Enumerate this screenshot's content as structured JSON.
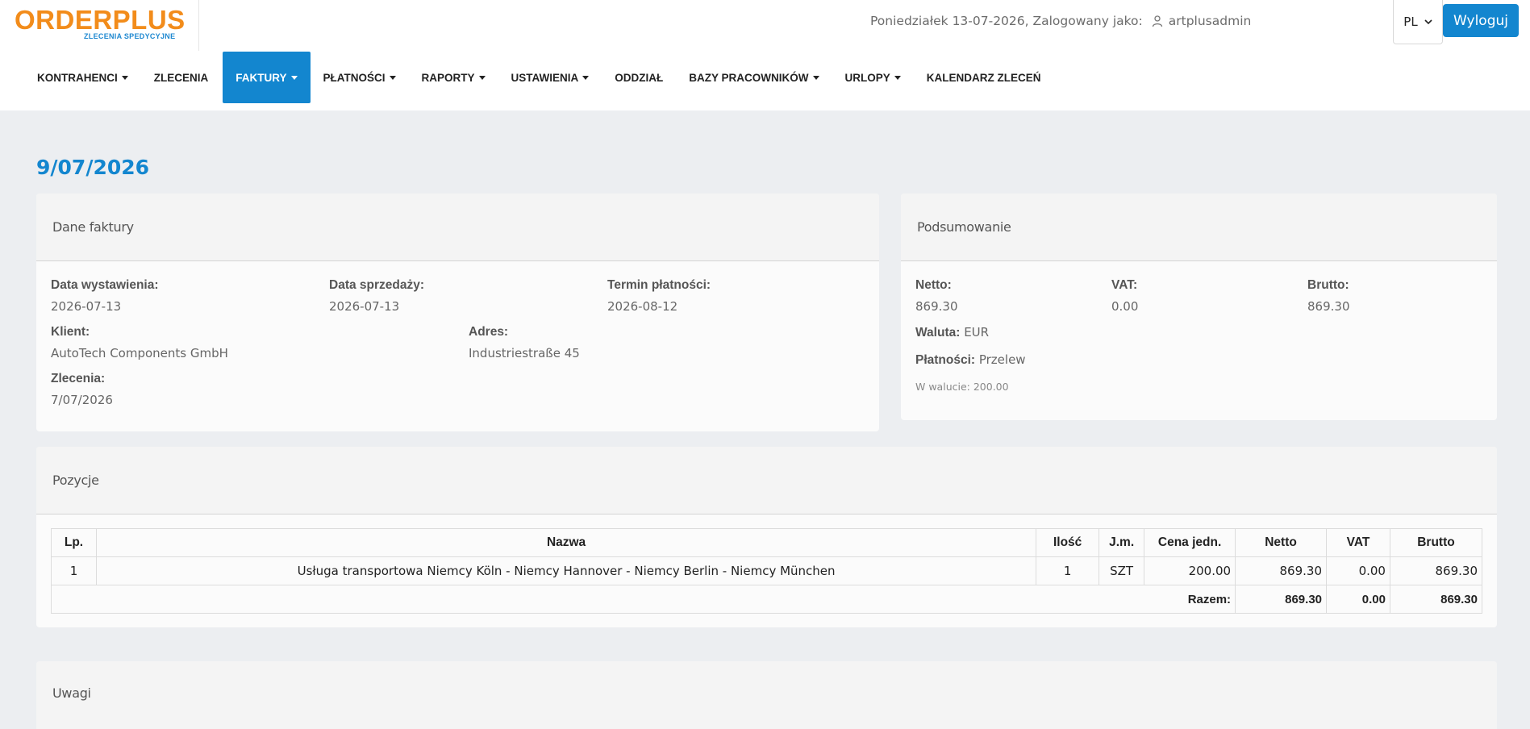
{
  "header": {
    "logo_main": "ORDERPLUS",
    "logo_sub": "ZLECENIA SPEDYCYJNE",
    "user_info": "Poniedziałek 13-07-2026, Zalogowany jako:",
    "username": "artplusadmin",
    "language": "PL",
    "logout_label": "Wyloguj"
  },
  "nav": [
    {
      "label": "KONTRAHENCI",
      "dropdown": true
    },
    {
      "label": "ZLECENIA",
      "dropdown": false
    },
    {
      "label": "FAKTURY",
      "dropdown": true,
      "active": true
    },
    {
      "label": "PŁATNOŚCI",
      "dropdown": true
    },
    {
      "label": "RAPORTY",
      "dropdown": true
    },
    {
      "label": "USTAWIENIA",
      "dropdown": true
    },
    {
      "label": "ODDZIAŁ",
      "dropdown": false
    },
    {
      "label": "BAZY PRACOWNIKÓW",
      "dropdown": true
    },
    {
      "label": "URLOPY",
      "dropdown": true
    },
    {
      "label": "KALENDARZ ZLECEŃ",
      "dropdown": false
    }
  ],
  "page_title": "9/07/2026",
  "invoice": {
    "header": "Dane faktury",
    "issue_date_label": "Data wystawienia:",
    "issue_date": "2026-07-13",
    "sale_date_label": "Data sprzedaży:",
    "sale_date": "2026-07-13",
    "due_date_label": "Termin płatności:",
    "due_date": "2026-08-12",
    "client_label": "Klient:",
    "client": "AutoTech Components GmbH",
    "address_label": "Adres:",
    "address": "Industriestraße 45",
    "orders_label": "Zlecenia:",
    "order_link": "7/07/2026"
  },
  "summary": {
    "header": "Podsumowanie",
    "net_label": "Netto:",
    "net": "869.30",
    "vat_label": "VAT:",
    "vat": "0.00",
    "gross_label": "Brutto:",
    "gross": "869.30",
    "currency_label": "Waluta:",
    "currency": "EUR",
    "payment_label": "Płatności:",
    "payment": "Przelew",
    "in_currency": "W walucie: 200.00"
  },
  "items": {
    "header": "Pozycje",
    "columns": [
      "Lp.",
      "Nazwa",
      "Ilość",
      "J.m.",
      "Cena jedn.",
      "Netto",
      "VAT",
      "Brutto"
    ],
    "rows": [
      {
        "lp": "1",
        "name": "Usługa transportowa Niemcy Köln - Niemcy Hannover - Niemcy Berlin - Niemcy München",
        "qty": "1",
        "unit": "SZT",
        "unit_price": "200.00",
        "net": "869.30",
        "vat": "0.00",
        "gross": "869.30"
      }
    ],
    "total_label": "Razem:",
    "total_net": "869.30",
    "total_vat": "0.00",
    "total_gross": "869.30"
  },
  "notes": {
    "header": "Uwagi"
  },
  "colors": {
    "accent": "#1386cf",
    "logo_orange": "#f28c1b",
    "background": "#eceef1"
  }
}
